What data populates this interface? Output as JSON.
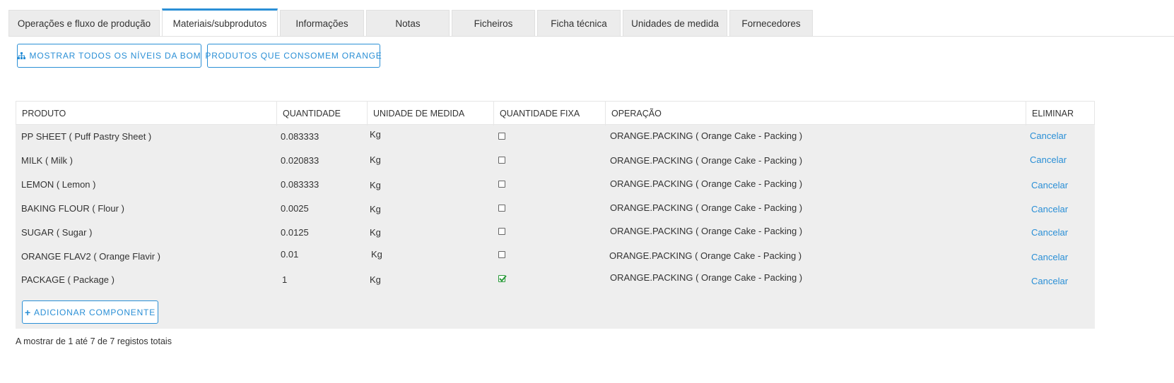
{
  "tabs": [
    {
      "label": "Operações e fluxo de produção",
      "active": false
    },
    {
      "label": "Materiais/subprodutos",
      "active": true
    },
    {
      "label": "Informações",
      "active": false
    },
    {
      "label": "Notas",
      "active": false
    },
    {
      "label": "Ficheiros",
      "active": false
    },
    {
      "label": "Ficha técnica",
      "active": false
    },
    {
      "label": "Unidades de medida",
      "active": false
    },
    {
      "label": "Fornecedores",
      "active": false
    }
  ],
  "toolbar": {
    "show_levels_label": "MOSTRAR TODOS OS NÍVEIS DA BOM",
    "consumers_label": "PRODUTOS QUE CONSOMEM ORANGE"
  },
  "table": {
    "headers": [
      "PRODUTO",
      "QUANTIDADE",
      "UNIDADE DE MEDIDA",
      "QUANTIDADE FIXA",
      "OPERAÇÃO",
      "ELIMINAR"
    ],
    "rows": [
      {
        "product": "PP SHEET ( Puff Pastry Sheet )",
        "qty": "0.083333",
        "unit": "Kg",
        "fixed": false,
        "operation": "ORANGE.PACKING ( Orange Cake - Packing )",
        "delete": "Cancelar"
      },
      {
        "product": "MILK ( Milk )",
        "qty": "0.020833",
        "unit": "Kg",
        "fixed": false,
        "operation": "ORANGE.PACKING ( Orange Cake - Packing )",
        "delete": "Cancelar"
      },
      {
        "product": "LEMON ( Lemon )",
        "qty": "0.083333",
        "unit": "Kg",
        "fixed": false,
        "operation": "ORANGE.PACKING ( Orange Cake - Packing )",
        "delete": "Cancelar"
      },
      {
        "product": "BAKING FLOUR ( Flour )",
        "qty": "0.0025",
        "unit": "Kg",
        "fixed": false,
        "operation": "ORANGE.PACKING ( Orange Cake - Packing )",
        "delete": "Cancelar"
      },
      {
        "product": "SUGAR ( Sugar )",
        "qty": "0.0125",
        "unit": "Kg",
        "fixed": false,
        "operation": "ORANGE.PACKING ( Orange Cake - Packing )",
        "delete": "Cancelar"
      },
      {
        "product": "ORANGE FLAV2 ( Orange Flavir )",
        "qty": "0.01",
        "unit": "Kg",
        "fixed": false,
        "operation": "ORANGE.PACKING ( Orange Cake - Packing )",
        "delete": "Cancelar"
      },
      {
        "product": "PACKAGE ( Package )",
        "qty": "1",
        "unit": "Kg",
        "fixed": true,
        "operation": "ORANGE.PACKING ( Orange Cake - Packing )",
        "delete": "Cancelar"
      }
    ],
    "add_label": "ADICIONAR COMPONENTE"
  },
  "footer": {
    "summary": "A mostrar de 1 até 7 de 7 registos totais"
  },
  "colors": {
    "accent": "#2a8fd6",
    "checked": "#2a9a3a",
    "table_bg": "#eeeeee",
    "tab_bg": "#ececec"
  }
}
